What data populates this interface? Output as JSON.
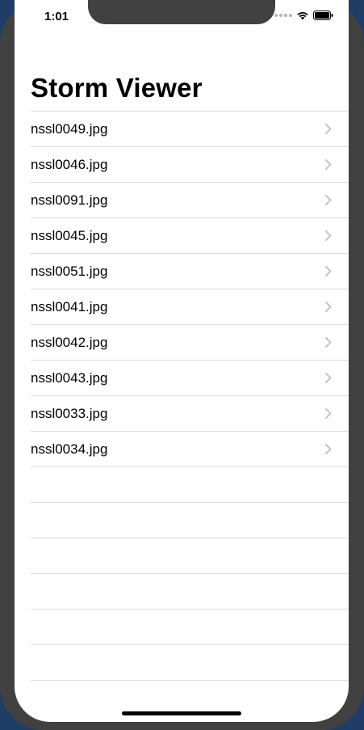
{
  "status_bar": {
    "time": "1:01",
    "icons": [
      "signal-dots-icon",
      "wifi-icon",
      "battery-icon"
    ]
  },
  "navigation": {
    "title": "Storm Viewer"
  },
  "list": {
    "items": [
      {
        "label": "nssl0049.jpg"
      },
      {
        "label": "nssl0046.jpg"
      },
      {
        "label": "nssl0091.jpg"
      },
      {
        "label": "nssl0045.jpg"
      },
      {
        "label": "nssl0051.jpg"
      },
      {
        "label": "nssl0041.jpg"
      },
      {
        "label": "nssl0042.jpg"
      },
      {
        "label": "nssl0043.jpg"
      },
      {
        "label": "nssl0033.jpg"
      },
      {
        "label": "nssl0034.jpg"
      }
    ],
    "accessory_icon": "chevron-right-icon"
  },
  "colors": {
    "background": "#ffffff",
    "separator": "#dcdcdc",
    "chevron": "#c4c4c7",
    "text": "#000000",
    "bezel": "#414141"
  }
}
